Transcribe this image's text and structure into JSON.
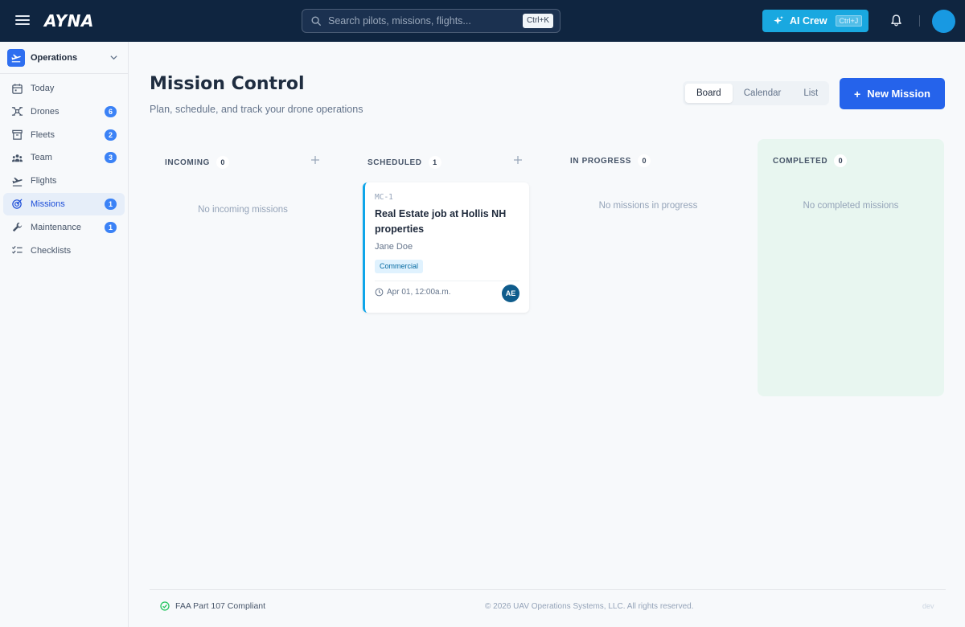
{
  "brand": {
    "logo_text": "AYNA"
  },
  "search": {
    "placeholder": "Search pilots, missions, flights...",
    "shortcut": "Ctrl+K"
  },
  "ai_crew": {
    "label": "AI Crew",
    "shortcut": "Ctrl+J"
  },
  "sidebar": {
    "org": "Operations",
    "items": [
      {
        "label": "Today",
        "icon": "calendar-icon"
      },
      {
        "label": "Drones",
        "icon": "drone-icon",
        "count": "6"
      },
      {
        "label": "Fleets",
        "icon": "archive-icon",
        "count": "2"
      },
      {
        "label": "Team",
        "icon": "team-icon",
        "count": "3"
      },
      {
        "label": "Flights",
        "icon": "plane-takeoff-icon"
      },
      {
        "label": "Missions",
        "icon": "target-icon",
        "count": "1",
        "active": true
      },
      {
        "label": "Maintenance",
        "icon": "wrench-icon",
        "count": "1"
      },
      {
        "label": "Checklists",
        "icon": "checklist-icon"
      }
    ]
  },
  "main": {
    "title": "Mission Control",
    "subtitle": "Plan, schedule, and track your drone operations",
    "views": [
      "Board",
      "Calendar",
      "List"
    ],
    "selected_view": "Board",
    "new_mission_label": "New Mission"
  },
  "board": {
    "columns": [
      {
        "name": "INCOMING",
        "count": "0",
        "empty": "No incoming missions"
      },
      {
        "name": "SCHEDULED",
        "count": "1"
      },
      {
        "name": "IN PROGRESS",
        "count": "0",
        "empty": "No missions in progress"
      },
      {
        "name": "COMPLETED",
        "count": "0",
        "empty": "No completed missions"
      }
    ],
    "card": {
      "code": "MC-1",
      "title": "Real Estate job at Hollis NH properties",
      "pilot": "Jane Doe",
      "tag": "Commercial",
      "when": "Apr 01, 12:00a.m.",
      "avatar": "AE"
    }
  },
  "footer": {
    "compliance": "FAA Part 107 Compliant",
    "copyright": "© 2026 UAV Operations Systems, LLC. All rights reserved.",
    "env": "dev"
  },
  "colors": {
    "topbar": "#0f2540",
    "primary": "#2563eb",
    "ai_crew": "#19a8e0",
    "completed_bg": "#e8f6f0"
  }
}
